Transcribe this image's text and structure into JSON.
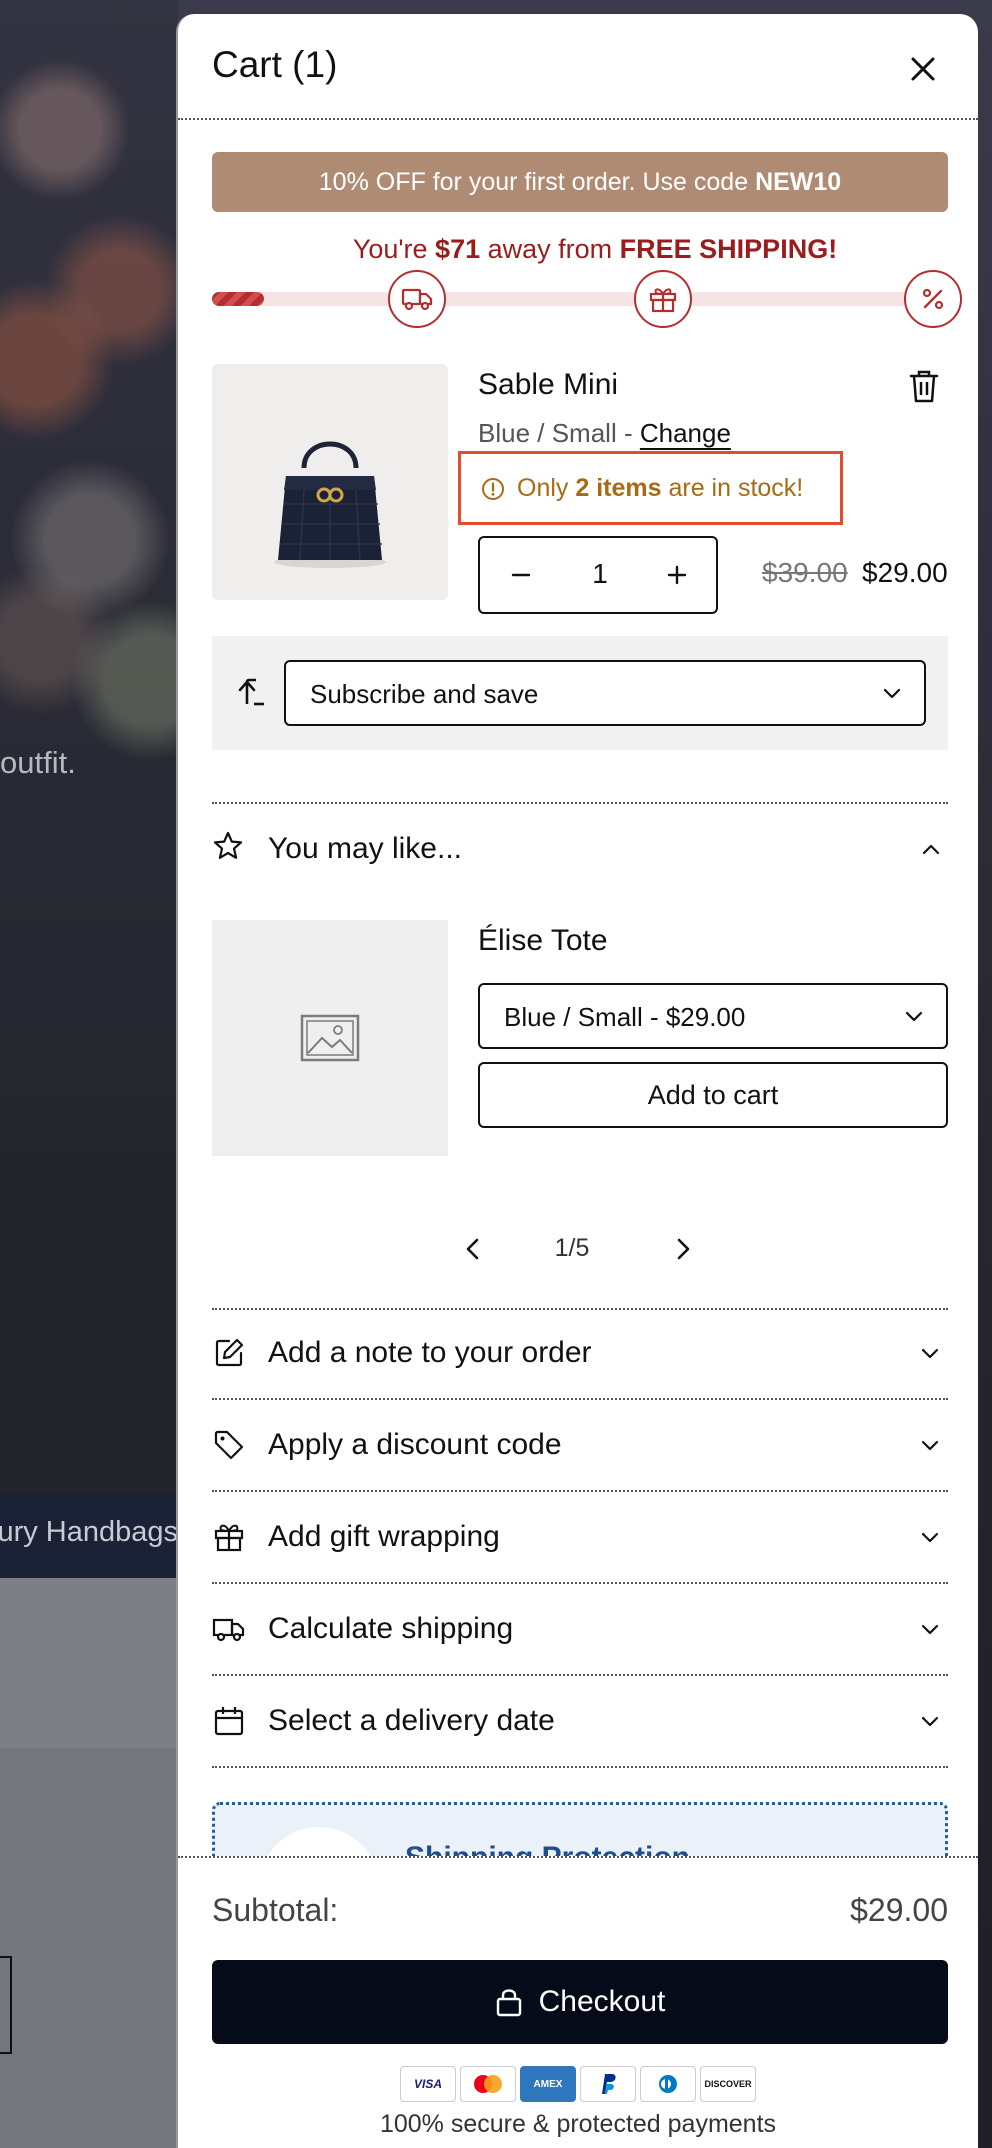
{
  "background": {
    "tagline": "outfit.",
    "band_text": "ury Handbags"
  },
  "cart": {
    "title": "Cart (1)",
    "promo": {
      "text_before": "10% OFF for your first order. Use code ",
      "code": "NEW10"
    },
    "free_shipping": {
      "prefix": "You're ",
      "amount": "$71",
      "middle": " away from ",
      "goal": "FREE SHIPPING!",
      "progress_fraction": 0.07
    },
    "milestones": [
      {
        "icon": "truck-icon"
      },
      {
        "icon": "gift-icon"
      },
      {
        "icon": "percent-icon"
      }
    ],
    "item": {
      "name": "Sable Mini",
      "variant": "Blue / Small - ",
      "change_label": "Change",
      "stock_prefix": "Only ",
      "stock_count": "2 items",
      "stock_suffix": " are in stock!",
      "quantity": "1",
      "price_old": "$39.00",
      "price_new": "$29.00"
    },
    "subscribe": {
      "selected": "Subscribe and save"
    },
    "you_may_like": {
      "label": "You may like...",
      "product_name": "Élise Tote",
      "option_selected": "Blue / Small - $29.00",
      "add_label": "Add to cart",
      "page": "1/5"
    },
    "accordions": [
      {
        "label": "Add a note to your order",
        "icon": "edit-icon"
      },
      {
        "label": "Apply a discount code",
        "icon": "tag-icon"
      },
      {
        "label": "Add gift wrapping",
        "icon": "gift-icon"
      },
      {
        "label": "Calculate shipping",
        "icon": "truck-icon"
      },
      {
        "label": "Select a delivery date",
        "icon": "calendar-icon"
      }
    ],
    "protection": {
      "title": "Shipping Protection"
    },
    "footer": {
      "subtotal_label": "Subtotal:",
      "subtotal_value": "$29.00",
      "checkout_label": "Checkout",
      "payments": [
        "VISA",
        "Mastercard",
        "AMEX",
        "PayPal",
        "Diners",
        "DISCOVER"
      ],
      "secure_text": "100% secure & protected payments"
    }
  },
  "colors": {
    "promo_bg": "#b08b74",
    "shipping_red": "#9b1c1c",
    "stock_amber": "#a76b14",
    "highlight_border": "#e04e2e",
    "checkout_bg": "#050b18",
    "protection_blue": "#1f4e8c"
  }
}
